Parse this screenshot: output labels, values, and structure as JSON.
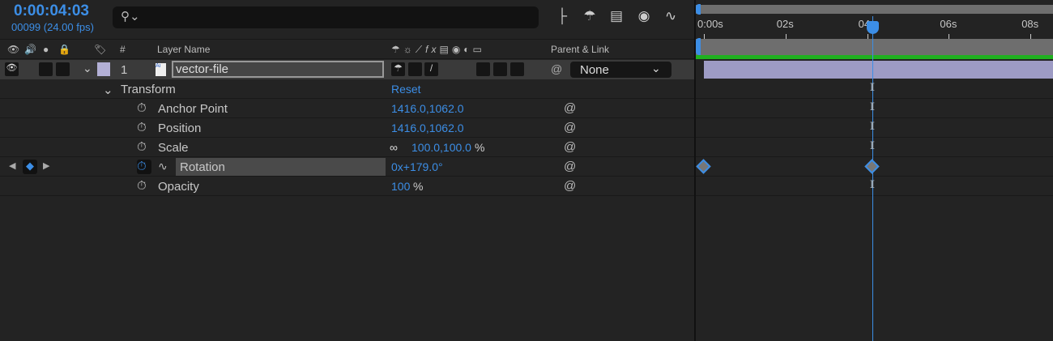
{
  "header": {
    "timecode": "0:00:04:03",
    "frames": "00099 (24.00 fps)",
    "search_icon": "search-icon"
  },
  "toolbar_icons": [
    "composition-flowchart-icon",
    "draft-3d-icon",
    "frame-blending-icon",
    "motion-blur-icon",
    "graph-editor-icon"
  ],
  "columns": {
    "number": "#",
    "layer_name": "Layer Name",
    "parent_link": "Parent & Link"
  },
  "layer": {
    "number": "1",
    "name": "vector-file",
    "parent": "None",
    "label_color": "#b3b0d6"
  },
  "transform": {
    "label": "Transform",
    "reset": "Reset",
    "properties": [
      {
        "name": "Anchor Point",
        "value": "1416.0,1062.0",
        "unit": ""
      },
      {
        "name": "Position",
        "value": "1416.0,1062.0",
        "unit": ""
      },
      {
        "name": "Scale",
        "value": "100.0,100.0",
        "unit": "%"
      },
      {
        "name": "Rotation",
        "value": "0x+179.0°",
        "unit": ""
      },
      {
        "name": "Opacity",
        "value": "100",
        "unit": "%"
      }
    ]
  },
  "timeline": {
    "ruler": [
      "0:00s",
      "02s",
      "04s",
      "06s",
      "08s"
    ],
    "playhead_seconds": 4.125,
    "rotation_keyframes_seconds": [
      0,
      4.125
    ],
    "accent": "#3c8ee6",
    "track_bar_color": "#9d9bc4"
  }
}
